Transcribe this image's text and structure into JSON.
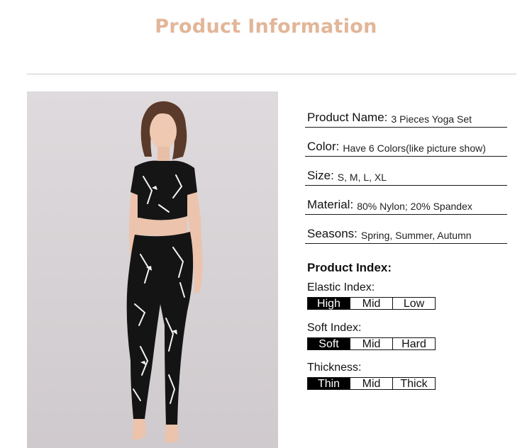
{
  "header": {
    "title": "Product Information"
  },
  "specs": [
    {
      "label": "Product Name:",
      "value": "3 Pieces Yoga Set"
    },
    {
      "label": "Color:",
      "value": "Have 6 Colors(like picture show)"
    },
    {
      "label": "Size:",
      "value": "S, M, L, XL"
    },
    {
      "label": "Material:",
      "value": "80% Nylon; 20% Spandex"
    },
    {
      "label": "Seasons:",
      "value": "Spring, Summer, Autumn"
    }
  ],
  "index": {
    "title": "Product Index:",
    "groups": [
      {
        "label": "Elastic Index:",
        "options": [
          "High",
          "Mid",
          "Low"
        ],
        "selected": "High"
      },
      {
        "label": "Soft Index:",
        "options": [
          "Soft",
          "Mid",
          "Hard"
        ],
        "selected": "Soft"
      },
      {
        "label": "Thickness:",
        "options": [
          "Thin",
          "Mid",
          "Thick"
        ],
        "selected": "Thin"
      }
    ]
  },
  "colors": {
    "title": "#e2b699",
    "photo_background": "#d9d4d8",
    "selected_cell": "#000000"
  }
}
